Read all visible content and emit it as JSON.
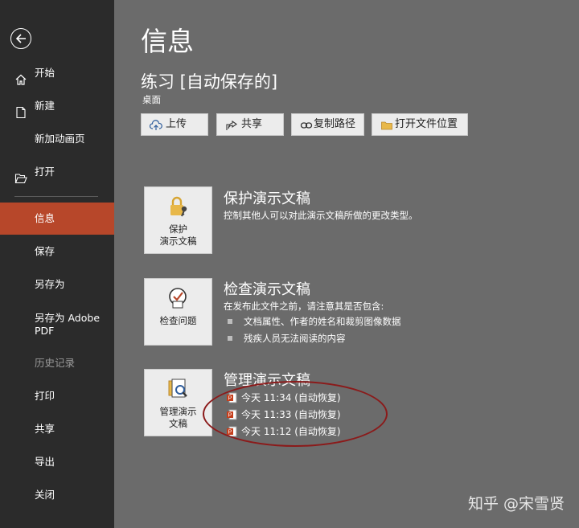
{
  "sidebar": {
    "items": [
      {
        "label": "开始"
      },
      {
        "label": "新建"
      },
      {
        "label": "新加动画页"
      },
      {
        "label": "打开"
      },
      {
        "label": "信息"
      },
      {
        "label": "保存"
      },
      {
        "label": "另存为"
      },
      {
        "label": "另存为 Adobe PDF"
      },
      {
        "label": "历史记录"
      },
      {
        "label": "打印"
      },
      {
        "label": "共享"
      },
      {
        "label": "导出"
      },
      {
        "label": "关闭"
      }
    ]
  },
  "main": {
    "title": "信息",
    "doc_title": "练习 [自动保存的]",
    "location": "桌面",
    "toolbar": {
      "upload": "上传",
      "share": "共享",
      "copy_path": "复制路径",
      "open_location": "打开文件位置"
    },
    "protect": {
      "button": "保护\n演示文稿",
      "title": "保护演示文稿",
      "desc": "控制其他人可以对此演示文稿所做的更改类型。"
    },
    "inspect": {
      "button": "检查问题",
      "title": "检查演示文稿",
      "desc": "在发布此文件之前，请注意其是否包含:",
      "bullets": [
        "文档属性、作者的姓名和裁剪图像数据",
        "残疾人员无法阅读的内容"
      ]
    },
    "manage": {
      "button": "管理演示\n文稿",
      "title": "管理演示文稿",
      "versions": [
        "今天 11:34 (自动恢复)",
        "今天 11:33 (自动恢复)",
        "今天 11:12 (自动恢复)"
      ]
    }
  },
  "watermark": "知乎 @宋雪贤",
  "colors": {
    "sidebar_bg": "#2b2b2b",
    "selected": "#b7472a",
    "main_bg": "#6b6b6b",
    "annotation": "#8b1a1a"
  }
}
